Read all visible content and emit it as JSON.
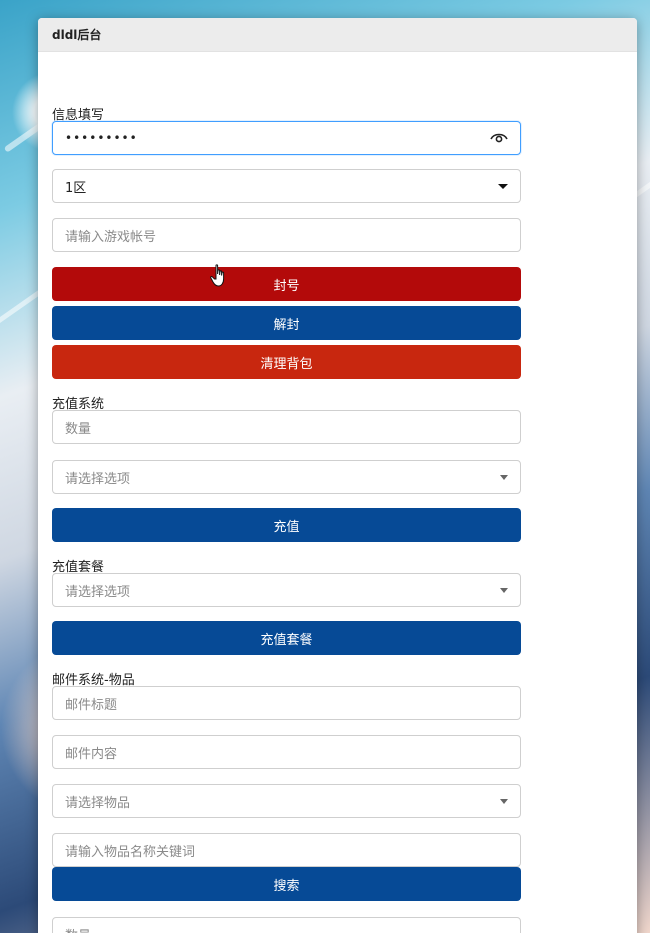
{
  "panel": {
    "title": "dldl后台"
  },
  "info": {
    "section_label": "信息填写",
    "password_value": "•••••••••",
    "zone_selected": "1区",
    "account_placeholder": "请输入游戏帐号",
    "ban_button": "封号",
    "unban_button": "解封",
    "clear_bag_button": "清理背包"
  },
  "recharge": {
    "section_label": "充值系统",
    "amount_placeholder": "数量",
    "option_placeholder": "请选择选项",
    "recharge_button": "充值"
  },
  "package": {
    "section_label": "充值套餐",
    "option_placeholder": "请选择选项",
    "package_button": "充值套餐"
  },
  "mail": {
    "section_label": "邮件系统-物品",
    "title_placeholder": "邮件标题",
    "content_placeholder": "邮件内容",
    "item_placeholder": "请选择物品",
    "keyword_placeholder": "请输入物品名称关键词",
    "search_button": "搜索",
    "quantity_placeholder": "数量"
  },
  "icons": {
    "eye": "eye-icon",
    "caret": "chevron-down-icon",
    "cursor": "hand-pointer-icon"
  },
  "colors": {
    "ban_red": "#b30a0a",
    "clear_red": "#c8270f",
    "primary_blue": "#064a96",
    "focus_blue": "#409eff"
  }
}
